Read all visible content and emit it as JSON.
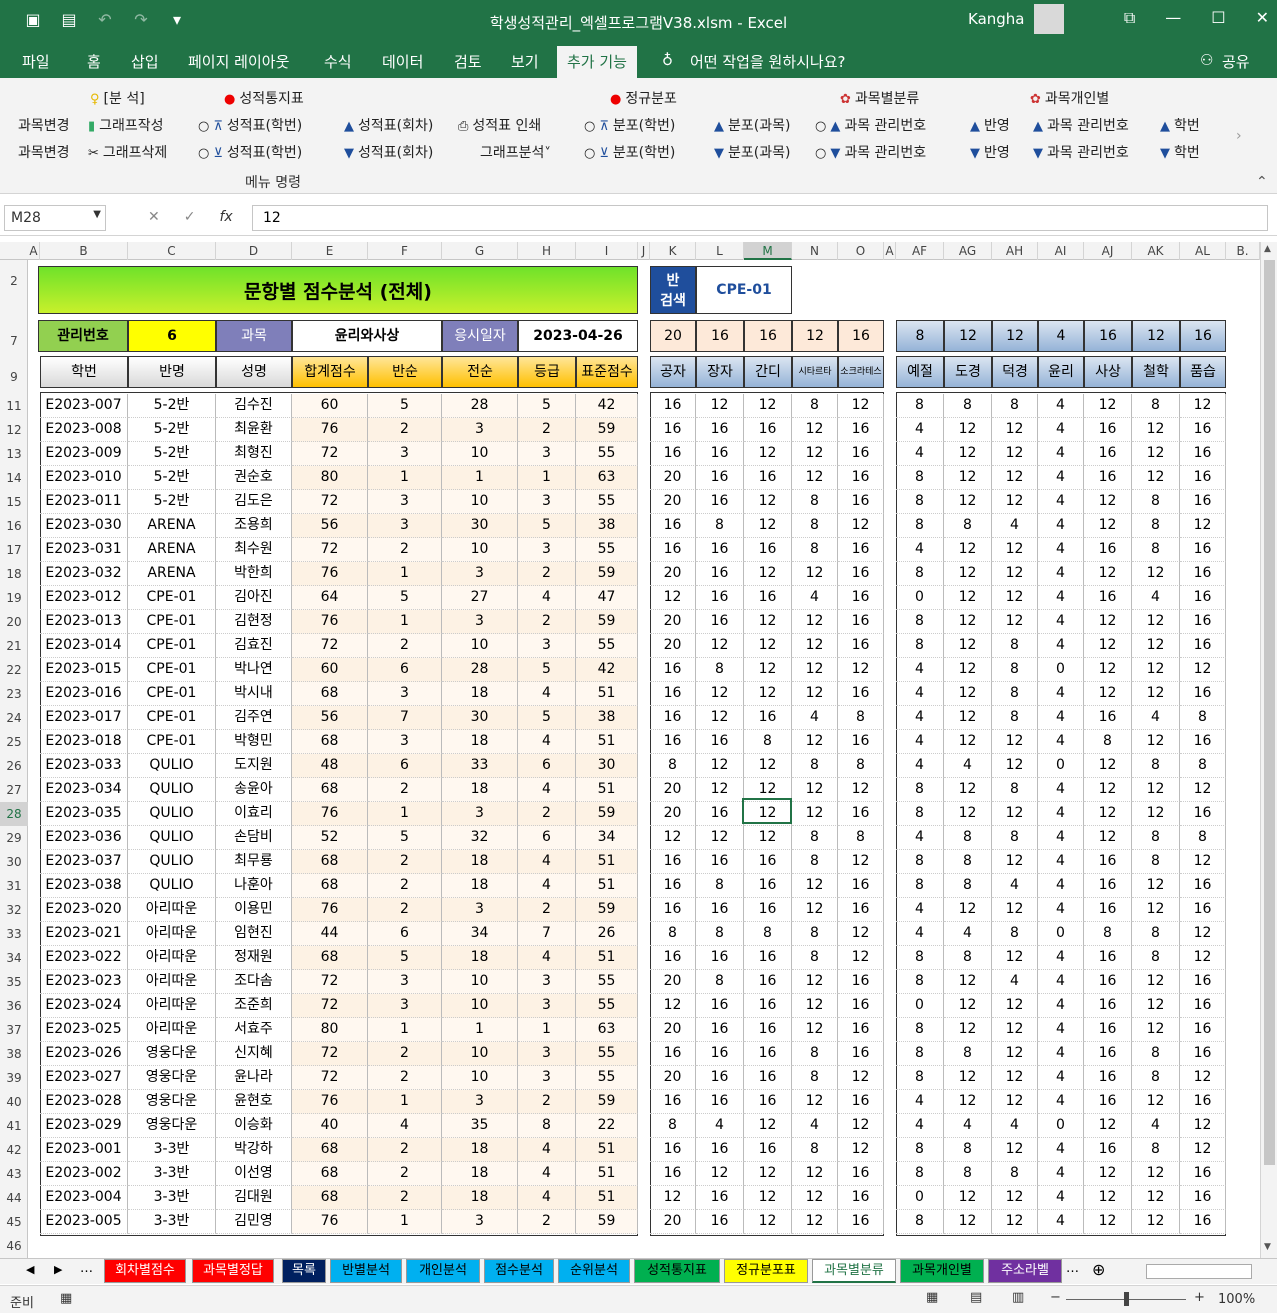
{
  "window": {
    "title": "학생성적관리_엑셀프로그램V38.xlsm  -  Excel",
    "user": "Kangha"
  },
  "menu": [
    "파일",
    "홈",
    "삽입",
    "페이지 레이아웃",
    "수식",
    "데이터",
    "검토",
    "보기",
    "추가 기능",
    "어떤 작업을 원하시나요?",
    "공유"
  ],
  "ribbon": {
    "groups": [
      "[분 석]",
      "성적통지표",
      "정규분포",
      "과목별분류",
      "과목개인별"
    ],
    "row1": [
      "과목변경",
      "그래프작성",
      "성적표(학번)",
      "성적표(회차)",
      "성적표 인쇄",
      "분포(학번)",
      "분포(과목)",
      "과목 관리번호",
      "반영",
      "과목 관리번호",
      "학번"
    ],
    "row2": [
      "과목변경",
      "그래프삭제",
      "성적표(학번)",
      "성적표(회차)",
      "그래프분석",
      "분포(학번)",
      "분포(과목)",
      "과목 관리번호",
      "반영",
      "과목 관리번호",
      "학번"
    ],
    "caption": "메뉴 명령"
  },
  "formula": {
    "namebox": "M28",
    "value": "12"
  },
  "cols": [
    "A",
    "B",
    "C",
    "D",
    "E",
    "F",
    "G",
    "H",
    "I",
    "J",
    "K",
    "L",
    "M",
    "N",
    "O",
    "A",
    "AF",
    "AG",
    "AH",
    "AI",
    "AJ",
    "AK",
    "AL",
    "B."
  ],
  "sheet": {
    "title": "문항별 점수분석 (전체)",
    "search_label_1": "반",
    "search_label_2": "검색",
    "search_value": "CPE-01",
    "mgmt_label": "관리번호",
    "mgmt_value": "6",
    "subject_label": "과목",
    "subject_value": "윤리와사상",
    "date_label": "응시일자",
    "date_value": "2023-04-26",
    "max_left": [
      "20",
      "16",
      "16",
      "12",
      "16"
    ],
    "max_right": [
      "8",
      "12",
      "12",
      "4",
      "16",
      "12",
      "16"
    ],
    "headers_main": [
      "학번",
      "반명",
      "성명",
      "합계점수",
      "반순",
      "전순",
      "등급",
      "표준점수"
    ],
    "headers_left": [
      "공자",
      "장자",
      "간디",
      "시타르타",
      "소크라테스"
    ],
    "headers_right": [
      "예절",
      "도경",
      "덕경",
      "윤리",
      "사상",
      "철학",
      "품습"
    ],
    "row_numbers": [
      "11",
      "12",
      "13",
      "14",
      "15",
      "16",
      "17",
      "18",
      "19",
      "20",
      "21",
      "22",
      "23",
      "24",
      "25",
      "26",
      "27",
      "28",
      "29",
      "30",
      "31",
      "32",
      "33",
      "34",
      "35",
      "36",
      "37",
      "38",
      "39",
      "40",
      "41",
      "42",
      "43",
      "44",
      "45",
      "46"
    ],
    "rows": [
      [
        "E2023-007",
        "5-2반",
        "김수진",
        "60",
        "5",
        "28",
        "5",
        "42",
        "16",
        "12",
        "12",
        "8",
        "12",
        "8",
        "8",
        "8",
        "4",
        "12",
        "8",
        "12"
      ],
      [
        "E2023-008",
        "5-2반",
        "최윤환",
        "76",
        "2",
        "3",
        "2",
        "59",
        "16",
        "16",
        "16",
        "12",
        "16",
        "4",
        "12",
        "12",
        "4",
        "16",
        "12",
        "16"
      ],
      [
        "E2023-009",
        "5-2반",
        "최형진",
        "72",
        "3",
        "10",
        "3",
        "55",
        "16",
        "16",
        "12",
        "12",
        "16",
        "4",
        "12",
        "12",
        "4",
        "16",
        "12",
        "16"
      ],
      [
        "E2023-010",
        "5-2반",
        "권순호",
        "80",
        "1",
        "1",
        "1",
        "63",
        "20",
        "16",
        "16",
        "12",
        "16",
        "8",
        "12",
        "12",
        "4",
        "16",
        "12",
        "16"
      ],
      [
        "E2023-011",
        "5-2반",
        "김도은",
        "72",
        "3",
        "10",
        "3",
        "55",
        "20",
        "16",
        "12",
        "8",
        "16",
        "8",
        "12",
        "12",
        "4",
        "12",
        "8",
        "16"
      ],
      [
        "E2023-030",
        "ARENA",
        "조용희",
        "56",
        "3",
        "30",
        "5",
        "38",
        "16",
        "8",
        "12",
        "8",
        "12",
        "8",
        "8",
        "4",
        "4",
        "12",
        "8",
        "12"
      ],
      [
        "E2023-031",
        "ARENA",
        "최수원",
        "72",
        "2",
        "10",
        "3",
        "55",
        "16",
        "16",
        "16",
        "8",
        "16",
        "4",
        "12",
        "12",
        "4",
        "16",
        "8",
        "16"
      ],
      [
        "E2023-032",
        "ARENA",
        "박한희",
        "76",
        "1",
        "3",
        "2",
        "59",
        "20",
        "16",
        "12",
        "12",
        "16",
        "8",
        "12",
        "12",
        "4",
        "12",
        "12",
        "16"
      ],
      [
        "E2023-012",
        "CPE-01",
        "김아진",
        "64",
        "5",
        "27",
        "4",
        "47",
        "12",
        "16",
        "16",
        "4",
        "16",
        "0",
        "12",
        "12",
        "4",
        "16",
        "4",
        "16"
      ],
      [
        "E2023-013",
        "CPE-01",
        "김현정",
        "76",
        "1",
        "3",
        "2",
        "59",
        "20",
        "16",
        "12",
        "12",
        "16",
        "8",
        "12",
        "12",
        "4",
        "12",
        "12",
        "16"
      ],
      [
        "E2023-014",
        "CPE-01",
        "김효진",
        "72",
        "2",
        "10",
        "3",
        "55",
        "20",
        "12",
        "12",
        "12",
        "16",
        "8",
        "12",
        "8",
        "4",
        "12",
        "12",
        "16"
      ],
      [
        "E2023-015",
        "CPE-01",
        "박나연",
        "60",
        "6",
        "28",
        "5",
        "42",
        "16",
        "8",
        "12",
        "12",
        "12",
        "4",
        "12",
        "8",
        "0",
        "12",
        "12",
        "12"
      ],
      [
        "E2023-016",
        "CPE-01",
        "박시내",
        "68",
        "3",
        "18",
        "4",
        "51",
        "16",
        "12",
        "12",
        "12",
        "16",
        "4",
        "12",
        "8",
        "4",
        "12",
        "12",
        "16"
      ],
      [
        "E2023-017",
        "CPE-01",
        "김주연",
        "56",
        "7",
        "30",
        "5",
        "38",
        "16",
        "12",
        "16",
        "4",
        "8",
        "4",
        "12",
        "8",
        "4",
        "16",
        "4",
        "8"
      ],
      [
        "E2023-018",
        "CPE-01",
        "박형민",
        "68",
        "3",
        "18",
        "4",
        "51",
        "16",
        "16",
        "8",
        "12",
        "16",
        "4",
        "12",
        "12",
        "4",
        "8",
        "12",
        "16"
      ],
      [
        "E2023-033",
        "QULIO",
        "도지원",
        "48",
        "6",
        "33",
        "6",
        "30",
        "8",
        "12",
        "12",
        "8",
        "8",
        "4",
        "4",
        "12",
        "0",
        "12",
        "8",
        "8"
      ],
      [
        "E2023-034",
        "QULIO",
        "송윤아",
        "68",
        "2",
        "18",
        "4",
        "51",
        "20",
        "12",
        "12",
        "12",
        "12",
        "8",
        "12",
        "8",
        "4",
        "12",
        "12",
        "12"
      ],
      [
        "E2023-035",
        "QULIO",
        "이효리",
        "76",
        "1",
        "3",
        "2",
        "59",
        "20",
        "16",
        "12",
        "12",
        "16",
        "8",
        "12",
        "12",
        "4",
        "12",
        "12",
        "16"
      ],
      [
        "E2023-036",
        "QULIO",
        "손담비",
        "52",
        "5",
        "32",
        "6",
        "34",
        "12",
        "12",
        "12",
        "8",
        "8",
        "4",
        "8",
        "8",
        "4",
        "12",
        "8",
        "8"
      ],
      [
        "E2023-037",
        "QULIO",
        "최무룡",
        "68",
        "2",
        "18",
        "4",
        "51",
        "16",
        "16",
        "16",
        "8",
        "12",
        "8",
        "8",
        "12",
        "4",
        "16",
        "8",
        "12"
      ],
      [
        "E2023-038",
        "QULIO",
        "나훈아",
        "68",
        "2",
        "18",
        "4",
        "51",
        "16",
        "8",
        "16",
        "12",
        "16",
        "8",
        "8",
        "4",
        "4",
        "16",
        "12",
        "16"
      ],
      [
        "E2023-020",
        "아리따운",
        "이용민",
        "76",
        "2",
        "3",
        "2",
        "59",
        "16",
        "16",
        "16",
        "12",
        "16",
        "4",
        "12",
        "12",
        "4",
        "16",
        "12",
        "16"
      ],
      [
        "E2023-021",
        "아리따운",
        "임현진",
        "44",
        "6",
        "34",
        "7",
        "26",
        "8",
        "8",
        "8",
        "8",
        "12",
        "4",
        "4",
        "8",
        "0",
        "8",
        "8",
        "12"
      ],
      [
        "E2023-022",
        "아리따운",
        "정재원",
        "68",
        "5",
        "18",
        "4",
        "51",
        "16",
        "16",
        "16",
        "8",
        "12",
        "8",
        "8",
        "12",
        "4",
        "16",
        "8",
        "12"
      ],
      [
        "E2023-023",
        "아리따운",
        "조다솜",
        "72",
        "3",
        "10",
        "3",
        "55",
        "20",
        "8",
        "16",
        "12",
        "16",
        "8",
        "12",
        "4",
        "4",
        "16",
        "12",
        "16"
      ],
      [
        "E2023-024",
        "아리따운",
        "조준희",
        "72",
        "3",
        "10",
        "3",
        "55",
        "12",
        "16",
        "16",
        "12",
        "16",
        "0",
        "12",
        "12",
        "4",
        "16",
        "12",
        "16"
      ],
      [
        "E2023-025",
        "아리따운",
        "서효주",
        "80",
        "1",
        "1",
        "1",
        "63",
        "20",
        "16",
        "16",
        "12",
        "16",
        "8",
        "12",
        "12",
        "4",
        "16",
        "12",
        "16"
      ],
      [
        "E2023-026",
        "영웅다운",
        "신지혜",
        "72",
        "2",
        "10",
        "3",
        "55",
        "16",
        "16",
        "16",
        "8",
        "16",
        "8",
        "8",
        "12",
        "4",
        "16",
        "8",
        "16"
      ],
      [
        "E2023-027",
        "영웅다운",
        "윤나라",
        "72",
        "2",
        "10",
        "3",
        "55",
        "20",
        "16",
        "16",
        "8",
        "12",
        "8",
        "12",
        "12",
        "4",
        "16",
        "8",
        "12"
      ],
      [
        "E2023-028",
        "영웅다운",
        "윤현호",
        "76",
        "1",
        "3",
        "2",
        "59",
        "16",
        "16",
        "16",
        "12",
        "16",
        "4",
        "12",
        "12",
        "4",
        "16",
        "12",
        "16"
      ],
      [
        "E2023-029",
        "영웅다운",
        "이승화",
        "40",
        "4",
        "35",
        "8",
        "22",
        "8",
        "4",
        "12",
        "4",
        "12",
        "4",
        "4",
        "4",
        "0",
        "12",
        "4",
        "12"
      ],
      [
        "E2023-001",
        "3-3반",
        "박강하",
        "68",
        "2",
        "18",
        "4",
        "51",
        "16",
        "16",
        "16",
        "8",
        "12",
        "8",
        "8",
        "12",
        "4",
        "16",
        "8",
        "12"
      ],
      [
        "E2023-002",
        "3-3반",
        "이선영",
        "68",
        "2",
        "18",
        "4",
        "51",
        "16",
        "12",
        "12",
        "12",
        "16",
        "8",
        "8",
        "8",
        "4",
        "12",
        "12",
        "16"
      ],
      [
        "E2023-004",
        "3-3반",
        "김대원",
        "68",
        "2",
        "18",
        "4",
        "51",
        "12",
        "16",
        "12",
        "12",
        "16",
        "0",
        "12",
        "12",
        "4",
        "12",
        "12",
        "16"
      ],
      [
        "E2023-005",
        "3-3반",
        "김민영",
        "76",
        "1",
        "3",
        "2",
        "59",
        "20",
        "16",
        "12",
        "12",
        "16",
        "8",
        "12",
        "12",
        "4",
        "12",
        "12",
        "16"
      ]
    ]
  },
  "tabs": [
    "회차별점수",
    "과목별정답",
    "목록",
    "반별분석",
    "개인분석",
    "점수분석",
    "순위분석",
    "성적통지표",
    "정규분포표",
    "과목별분류",
    "과목개인별",
    "주소라벨"
  ],
  "tab_colors": [
    "#ff0000",
    "#ff0000",
    "#002060",
    "#00b0f0",
    "#00b0f0",
    "#00b0f0",
    "#00b0f0",
    "#00b050",
    "#ffff00",
    "#ffffff",
    "#00b050",
    "#7030a0"
  ],
  "status": {
    "ready": "준비",
    "zoom": "100%"
  }
}
